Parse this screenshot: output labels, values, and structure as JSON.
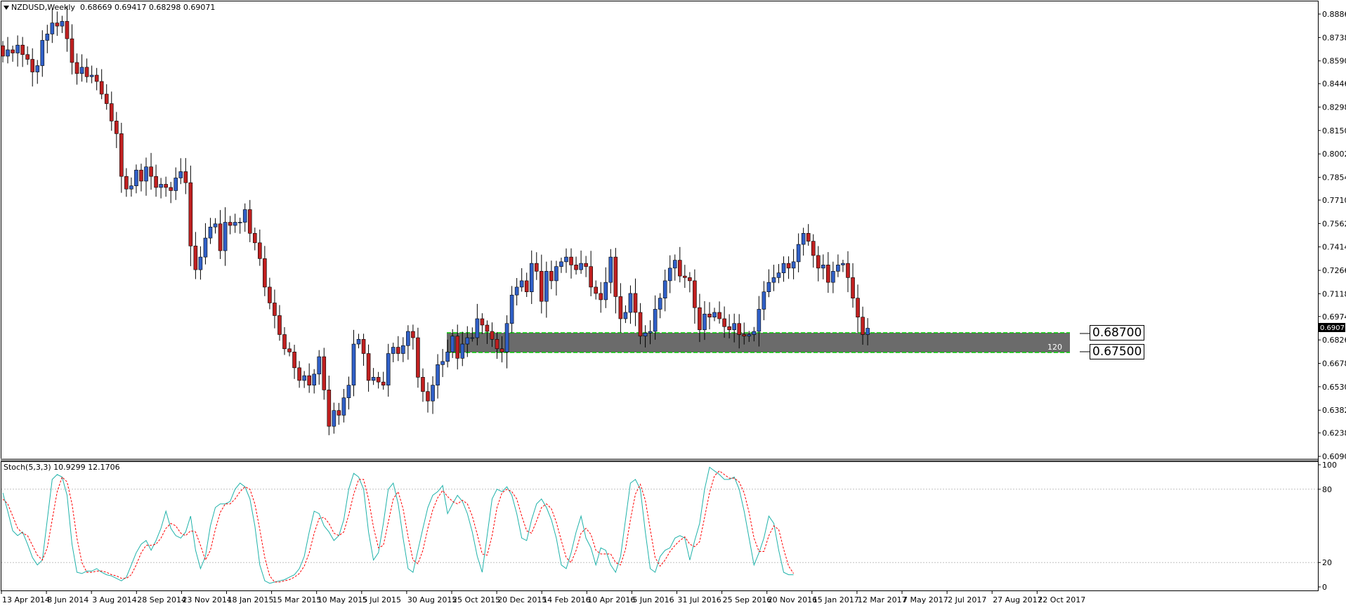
{
  "header": {
    "dropdown_icon": "triangle-down-icon",
    "symbol": "NZDUSD,Weekly",
    "ohlc": "0.68669 0.69417 0.68298 0.69071"
  },
  "indicator": {
    "label": "Stoch(5,3,3) 10.9299 12.1706"
  },
  "current_price_tag": "0.69071",
  "zone": {
    "upper_label": "0.68700",
    "lower_label": "0.67500",
    "count_label": "120",
    "color": "#6b6b6b",
    "border_color": "#00c800"
  },
  "colors": {
    "bull": "#3060c8",
    "bear": "#c02020",
    "stoch_main": "#20b2aa",
    "stoch_signal": "#ff0000"
  },
  "chart_data": [
    {
      "type": "candlestick",
      "title": "NZDUSD,Weekly",
      "ylim": [
        0.609,
        0.89
      ],
      "y_ticks": [
        "0.88862",
        "0.87380",
        "0.85900",
        "0.84460",
        "0.82980",
        "0.81500",
        "0.80020",
        "0.78540",
        "0.77100",
        "0.75620",
        "0.74140",
        "0.72660",
        "0.71180",
        "0.69740",
        "0.68260",
        "0.66780",
        "0.65300",
        "0.63820",
        "0.62380",
        "0.60900"
      ],
      "x_ticks": [
        "13 Apr 2014",
        "8 Jun 2014",
        "3 Aug 2014",
        "28 Sep 2014",
        "23 Nov 2014",
        "18 Jan 2015",
        "15 Mar 2015",
        "10 May 2015",
        "5 Jul 2015",
        "30 Aug 2015",
        "25 Oct 2015",
        "20 Dec 2015",
        "14 Feb 2016",
        "10 Apr 2016",
        "5 Jun 2016",
        "31 Jul 2016",
        "25 Sep 2016",
        "20 Nov 2016",
        "15 Jan 2017",
        "12 Mar 2017",
        "7 May 2017",
        "2 Jul 2017",
        "27 Aug 2017",
        "22 Oct 2017"
      ],
      "close": [
        0.862,
        0.866,
        0.864,
        0.869,
        0.863,
        0.86,
        0.852,
        0.856,
        0.872,
        0.876,
        0.883,
        0.881,
        0.884,
        0.873,
        0.858,
        0.851,
        0.855,
        0.849,
        0.85,
        0.846,
        0.838,
        0.832,
        0.821,
        0.813,
        0.786,
        0.778,
        0.78,
        0.79,
        0.783,
        0.792,
        0.786,
        0.779,
        0.781,
        0.779,
        0.777,
        0.785,
        0.789,
        0.782,
        0.742,
        0.727,
        0.735,
        0.747,
        0.754,
        0.756,
        0.739,
        0.757,
        0.755,
        0.757,
        0.757,
        0.765,
        0.75,
        0.744,
        0.734,
        0.716,
        0.706,
        0.698,
        0.686,
        0.677,
        0.675,
        0.665,
        0.657,
        0.66,
        0.654,
        0.661,
        0.672,
        0.651,
        0.628,
        0.638,
        0.635,
        0.646,
        0.654,
        0.68,
        0.683,
        0.674,
        0.657,
        0.659,
        0.656,
        0.654,
        0.674,
        0.678,
        0.674,
        0.679,
        0.688,
        0.684,
        0.659,
        0.65,
        0.644,
        0.654,
        0.667,
        0.669,
        0.675,
        0.685,
        0.671,
        0.68,
        0.684,
        0.684,
        0.696,
        0.692,
        0.688,
        0.683,
        0.677,
        0.675,
        0.693,
        0.711,
        0.716,
        0.72,
        0.713,
        0.731,
        0.726,
        0.707,
        0.726,
        0.72,
        0.729,
        0.732,
        0.735,
        0.73,
        0.727,
        0.731,
        0.729,
        0.716,
        0.712,
        0.708,
        0.719,
        0.735,
        0.71,
        0.696,
        0.7,
        0.712,
        0.7,
        0.685,
        0.687,
        0.688,
        0.702,
        0.709,
        0.72,
        0.728,
        0.733,
        0.723,
        0.722,
        0.72,
        0.703,
        0.689,
        0.699,
        0.697,
        0.7,
        0.696,
        0.691,
        0.689,
        0.693,
        0.686,
        0.685,
        0.686,
        0.688,
        0.702,
        0.713,
        0.719,
        0.722,
        0.725,
        0.731,
        0.728,
        0.732,
        0.743,
        0.75,
        0.745,
        0.736,
        0.728,
        0.73,
        0.719,
        0.726,
        0.73,
        0.731,
        0.722,
        0.709,
        0.697,
        0.686,
        0.69
      ],
      "stoch_main": [
        77,
        62,
        46,
        42,
        45,
        35,
        24,
        18,
        22,
        55,
        88,
        92,
        90,
        75,
        35,
        12,
        11,
        13,
        13,
        15,
        12,
        10,
        9,
        7,
        5,
        8,
        18,
        28,
        35,
        38,
        30,
        38,
        48,
        62,
        48,
        42,
        40,
        45,
        58,
        30,
        15,
        25,
        50,
        65,
        68,
        68,
        70,
        80,
        85,
        82,
        72,
        50,
        18,
        5,
        3,
        4,
        5,
        6,
        8,
        10,
        15,
        25,
        45,
        62,
        60,
        50,
        45,
        38,
        42,
        55,
        80,
        93,
        90,
        80,
        45,
        22,
        28,
        52,
        80,
        85,
        68,
        40,
        15,
        12,
        30,
        48,
        65,
        75,
        78,
        83,
        60,
        68,
        75,
        70,
        60,
        45,
        25,
        12,
        42,
        72,
        80,
        78,
        82,
        75,
        60,
        40,
        38,
        55,
        68,
        72,
        65,
        55,
        40,
        18,
        15,
        28,
        45,
        58,
        40,
        32,
        18,
        32,
        30,
        18,
        12,
        25,
        55,
        85,
        88,
        80,
        45,
        15,
        12,
        25,
        30,
        32,
        40,
        42,
        40,
        22,
        38,
        52,
        80,
        98,
        95,
        92,
        88,
        88,
        90,
        80,
        62,
        40,
        18,
        28,
        40,
        58,
        52,
        30,
        12,
        10,
        10
      ],
      "stoch_signal": [
        72,
        68,
        58,
        48,
        44,
        42,
        34,
        26,
        22,
        32,
        55,
        78,
        90,
        86,
        68,
        40,
        20,
        12,
        12,
        13,
        13,
        12,
        10,
        9,
        7,
        7,
        10,
        18,
        28,
        34,
        34,
        35,
        40,
        48,
        52,
        50,
        44,
        42,
        46,
        45,
        34,
        22,
        30,
        47,
        61,
        68,
        68,
        72,
        78,
        82,
        80,
        68,
        47,
        24,
        9,
        4,
        4,
        5,
        6,
        8,
        11,
        17,
        28,
        44,
        56,
        57,
        52,
        44,
        42,
        45,
        59,
        76,
        88,
        88,
        72,
        49,
        32,
        34,
        53,
        72,
        78,
        64,
        41,
        22,
        19,
        30,
        48,
        63,
        73,
        79,
        74,
        70,
        68,
        71,
        68,
        58,
        43,
        27,
        26,
        42,
        65,
        77,
        80,
        78,
        72,
        58,
        46,
        44,
        54,
        65,
        68,
        64,
        53,
        38,
        24,
        20,
        30,
        44,
        48,
        43,
        30,
        27,
        27,
        27,
        20,
        18,
        31,
        55,
        76,
        84,
        71,
        47,
        24,
        17,
        22,
        29,
        34,
        38,
        41,
        35,
        33,
        37,
        57,
        77,
        91,
        95,
        92,
        89,
        89,
        86,
        77,
        61,
        40,
        29,
        29,
        42,
        50,
        47,
        31,
        17,
        11
      ]
    }
  ]
}
